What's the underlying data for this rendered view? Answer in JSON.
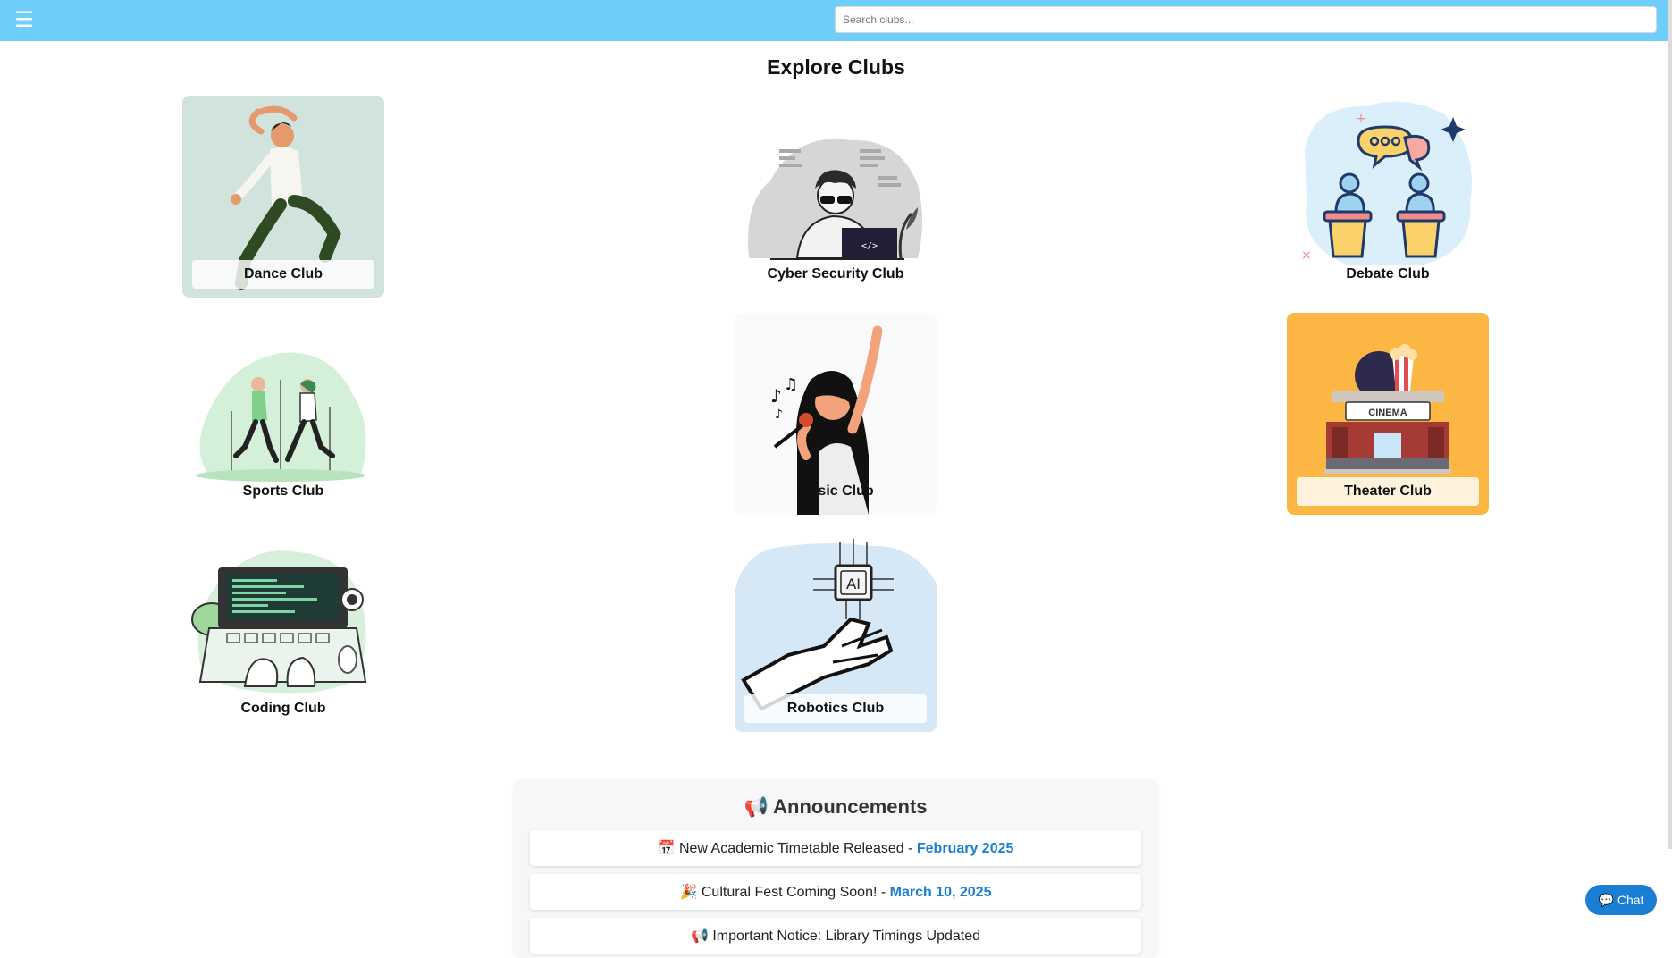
{
  "header": {
    "menu_icon": "hamburger-menu-icon",
    "menu_glyph": "☰",
    "search_placeholder": "Search clubs...",
    "bg_color": "#6fcdf9"
  },
  "page_title": "Explore Clubs",
  "clubs": [
    {
      "label": "Dance Club",
      "icon": "dancer-illustration"
    },
    {
      "label": "Cyber Security Club",
      "icon": "hacker-illustration"
    },
    {
      "label": "Debate Club",
      "icon": "debate-illustration"
    },
    {
      "label": "Sports Club",
      "icon": "runners-illustration"
    },
    {
      "label": "Music Club",
      "icon": "singer-illustration"
    },
    {
      "label": "Theater Club",
      "icon": "cinema-illustration"
    },
    {
      "label": "Coding Club",
      "icon": "laptop-coding-illustration"
    },
    {
      "label": "Robotics Club",
      "icon": "robot-hand-ai-illustration"
    }
  ],
  "announcements": {
    "title": "Announcements",
    "title_icon": "📢",
    "items": [
      {
        "icon": "📅",
        "text": "New Academic Timetable Released - ",
        "date": "February 2025"
      },
      {
        "icon": "🎉",
        "text": "Cultural Fest Coming Soon! - ",
        "date": "March 10, 2025"
      },
      {
        "icon": "📢",
        "text": "Important Notice: Library Timings Updated",
        "date": ""
      }
    ]
  },
  "chat": {
    "icon": "💬",
    "label": "Chat"
  },
  "accent_color": "#1a7fd4"
}
